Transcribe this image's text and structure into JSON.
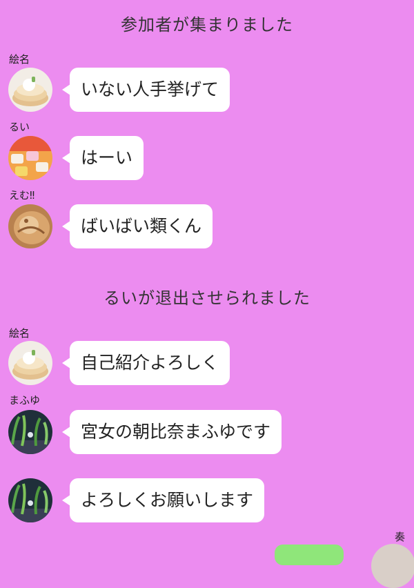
{
  "system_messages": {
    "joined": "参加者が集まりました",
    "removed": "るいが退出させられました"
  },
  "messages": [
    {
      "sender": "絵名",
      "text": "いない人手挙げて",
      "avatar": "pancake-avatar"
    },
    {
      "sender": "るい",
      "text": "はーい",
      "avatar": "sweets-avatar"
    },
    {
      "sender": "えむ‼",
      "text": "ばいばい類くん",
      "avatar": "bread-avatar"
    },
    {
      "sender": "絵名",
      "text": "自己紹介よろしく",
      "avatar": "pancake-avatar"
    },
    {
      "sender": "まふゆ",
      "text": "宮女の朝比奈まふゆです",
      "avatar": "aquarium-avatar"
    },
    {
      "sender": "",
      "text": "よろしくお願いします",
      "avatar": "aquarium-avatar"
    }
  ],
  "own": {
    "sender": "奏"
  },
  "colors": {
    "background": "#ec8cf0",
    "bubble_incoming": "#ffffff",
    "bubble_outgoing": "#8fe67a"
  }
}
